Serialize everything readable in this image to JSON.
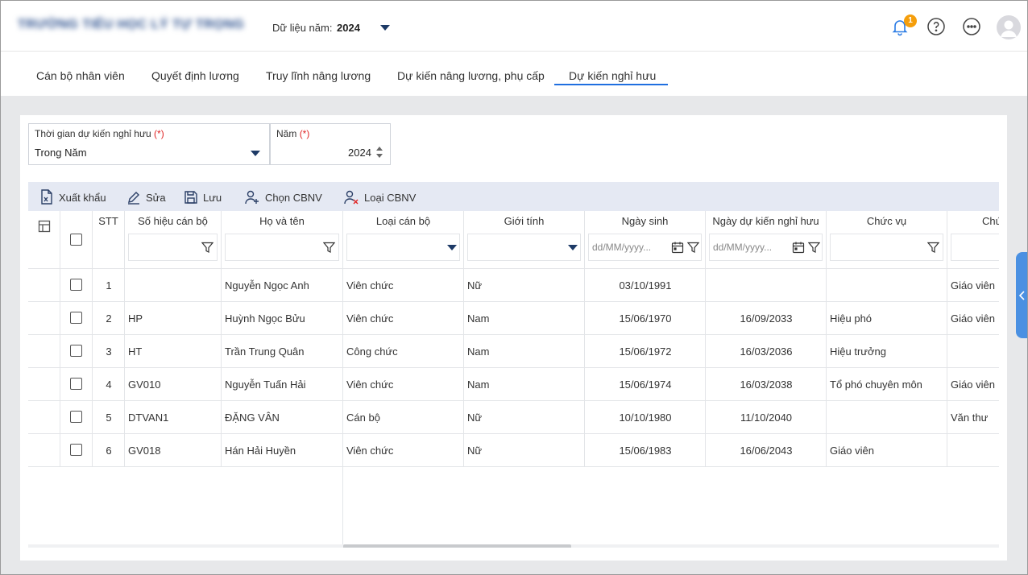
{
  "header": {
    "school_name": "TRƯỜNG TIỂU HỌC LÝ TỰ TRỌNG",
    "year_label": "Dữ liệu năm:",
    "year_value": "2024",
    "notification_count": "1"
  },
  "tabs": [
    {
      "label": "Cán bộ nhân viên"
    },
    {
      "label": "Quyết định lương"
    },
    {
      "label": "Truy lĩnh nâng lương"
    },
    {
      "label": "Dự kiến nâng lương, phụ cấp"
    },
    {
      "label": "Dự kiến nghỉ hưu"
    }
  ],
  "filters": {
    "period": {
      "label": "Thời gian dự kiến nghỉ hưu",
      "required": "(*)",
      "value": "Trong Năm"
    },
    "year": {
      "label": "Năm",
      "required": "(*)",
      "value": "2024"
    }
  },
  "toolbar": {
    "export": "Xuất khẩu",
    "edit": "Sửa",
    "save": "Lưu",
    "choose": "Chọn CBNV",
    "remove": "Loại CBNV"
  },
  "table": {
    "columns": {
      "stt": "STT",
      "code": "Số hiệu cán bộ",
      "name": "Họ và tên",
      "type": "Loại cán bộ",
      "gender": "Giới tính",
      "dob": "Ngày sinh",
      "retire": "Ngày dự kiến nghỉ hưu",
      "position": "Chức vụ",
      "title": "Chức danh"
    },
    "date_placeholder": "dd/MM/yyyy...",
    "rows": [
      {
        "stt": "1",
        "code": "",
        "name": "Nguyễn Ngọc Anh",
        "type": "Viên chức",
        "gender": "Nữ",
        "dob": "03/10/1991",
        "retire": "",
        "position": "",
        "title": "Giáo viên"
      },
      {
        "stt": "2",
        "code": "HP",
        "name": "Huỳnh Ngọc Bửu",
        "type": "Viên chức",
        "gender": "Nam",
        "dob": "15/06/1970",
        "retire": "16/09/2033",
        "position": "Hiệu phó",
        "title": "Giáo viên"
      },
      {
        "stt": "3",
        "code": "HT",
        "name": "Trần Trung Quân",
        "type": "Công chức",
        "gender": "Nam",
        "dob": "15/06/1972",
        "retire": "16/03/2036",
        "position": "Hiệu trưởng",
        "title": ""
      },
      {
        "stt": "4",
        "code": "GV010",
        "name": "Nguyễn Tuấn Hải",
        "type": "Viên chức",
        "gender": "Nam",
        "dob": "15/06/1974",
        "retire": "16/03/2038",
        "position": "Tổ phó chuyên môn",
        "title": "Giáo viên"
      },
      {
        "stt": "5",
        "code": "DTVAN1",
        "name": "ĐẶNG VÂN",
        "type": "Cán bộ",
        "gender": "Nữ",
        "dob": "10/10/1980",
        "retire": "11/10/2040",
        "position": "",
        "title": "Văn thư"
      },
      {
        "stt": "6",
        "code": "GV018",
        "name": "Hán Hải Huyền",
        "type": "Viên chức",
        "gender": "Nữ",
        "dob": "15/06/1983",
        "retire": "16/06/2043",
        "position": "Giáo viên",
        "title": ""
      }
    ]
  },
  "colors": {
    "accent": "#1f6fe0",
    "toolbar_bg": "#e5e9f3",
    "badge": "#f59e0b",
    "required": "#e02424"
  }
}
